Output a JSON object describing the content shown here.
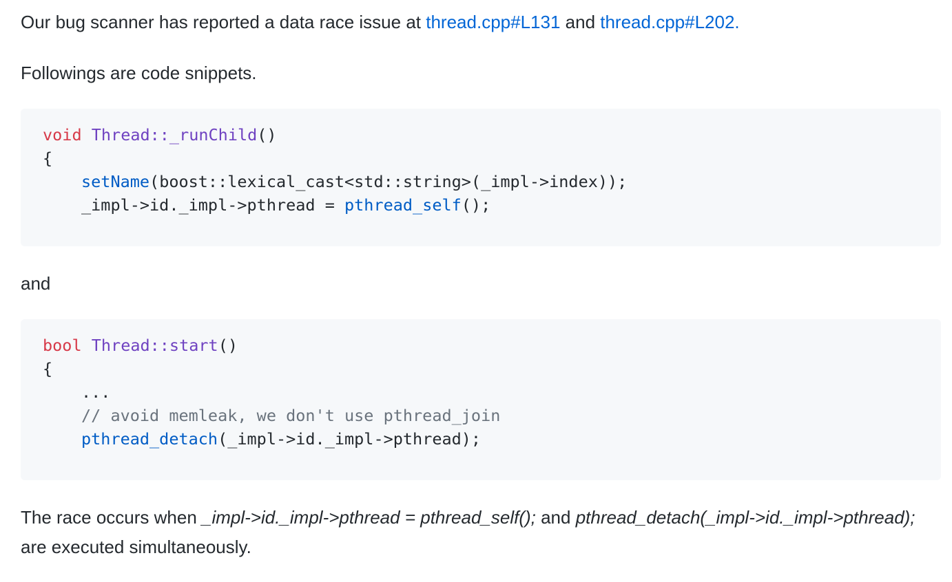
{
  "intro": {
    "prefix": "Our bug scanner has reported a data race issue at ",
    "link1": "thread.cpp#L131",
    "middle": " and ",
    "link2": "thread.cpp#L202."
  },
  "followings": "Followings are code snippets.",
  "code1": {
    "line1_kw": "void",
    "line1_space": " ",
    "line1_entity": "Thread::_runChild",
    "line1_rest": "()",
    "line2": "{",
    "line3_fn": "setName",
    "line3_rest": "(boost::lexical_cast<std::string>(_impl->index));",
    "line4_pre": "_impl->id._impl->pthread = ",
    "line4_fn": "pthread_self",
    "line4_rest": "();"
  },
  "and_text": "and",
  "code2": {
    "line1_kw": "bool",
    "line1_space": " ",
    "line1_entity": "Thread::start",
    "line1_rest": "()",
    "line2": "{",
    "line3": "...",
    "line4_comment": "// avoid memleak, we don't use pthread_join",
    "line5_fn": "pthread_detach",
    "line5_rest": "(_impl->id._impl->pthread);"
  },
  "conclusion": {
    "prefix": "The race occurs when ",
    "em1": "_impl->id._impl->pthread = pthread_self();",
    "middle": " and ",
    "em2": "pthread_detach(_impl->id._impl->pthread);",
    "suffix": " are executed simultaneously."
  }
}
